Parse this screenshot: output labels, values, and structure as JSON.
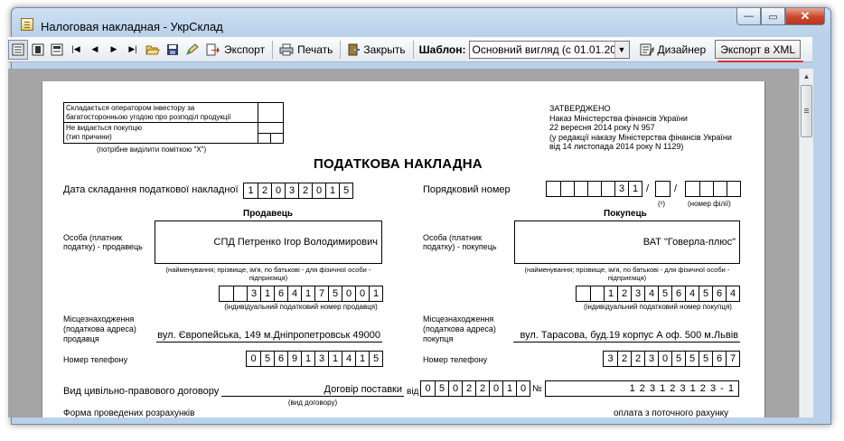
{
  "window": {
    "title": "Налоговая накладная - УкрСклад"
  },
  "toolbar": {
    "export_label": "Экспорт",
    "print_label": "Печать",
    "close_label": "Закрыть",
    "template_label": "Шаблон:",
    "template_value": "Основний вигляд (с 01.01.201!",
    "designer_label": "Дизайнер",
    "xml_export_label": "Экспорт в XML"
  },
  "doc": {
    "top_box": {
      "line1": "Складається оператором інвестору за",
      "line2": "багатосторонньою угодою про розподіл продукції",
      "line3": "Не видається покупцю",
      "line4": "(тип причини)",
      "note": "(потрібне виділити поміткою \"Х\")"
    },
    "approval": {
      "line1": "ЗАТВЕРДЖЕНО",
      "line2": "Наказ Міністерства фінансів України",
      "line3": "22 вересня 2014 року N 957",
      "line4": "(у редакції наказу Міністерства фінансів України",
      "line5": "від 14 листопада 2014 року N 1129)"
    },
    "title": "ПОДАТКОВА НАКЛАДНА",
    "date_label": "Дата складання податкової накладної",
    "date_digits": [
      "1",
      "2",
      "0",
      "3",
      "2",
      "0",
      "1",
      "5"
    ],
    "number_label": "Порядковий номер",
    "number_digits": [
      "",
      "",
      "",
      "",
      "",
      "3",
      "1"
    ],
    "number_sep1": "/",
    "number_sep2": "/",
    "number_note1": "(¹)",
    "number_note2": "(номер філії)",
    "seller": {
      "heading": "Продавець",
      "person_label_1": "Особа (платник",
      "person_label_2": "податку) - продавець",
      "name": "СПД Петренко Ігор Володимирович",
      "name_note_1": "(найменування; прізвище, ім'я, по батькові - для фізичної особи -",
      "name_note_2": "підприємця)",
      "ipn_digits": [
        "",
        "",
        "3",
        "1",
        "6",
        "4",
        "1",
        "7",
        "5",
        "0",
        "0",
        "1"
      ],
      "ipn_note": "(індивідуальний податковий номер продавця)",
      "address_label_1": "Місцезнаходження",
      "address_label_2": "(податкова адреса)",
      "address_label_3": "продавця",
      "address": "вул. Європейська, 149 м.Дніпропетровськ 49000",
      "phone_label": "Номер телефону",
      "phone_digits": [
        "0",
        "5",
        "6",
        "9",
        "1",
        "3",
        "1",
        "4",
        "1",
        "5"
      ]
    },
    "buyer": {
      "heading": "Покупець",
      "person_label_1": "Особа (платник",
      "person_label_2": "податку) - покупець",
      "name": "ВАТ \"Говерла-плюс\"",
      "name_note_1": "(найменування; прізвище, ім'я, по батькові - для фізичної особи -",
      "name_note_2": "підприємця)",
      "ipn_digits": [
        "",
        "",
        "1",
        "2",
        "3",
        "4",
        "5",
        "6",
        "4",
        "5",
        "6",
        "4"
      ],
      "ipn_note": "(індивідуальний податковий номер покупця)",
      "address_label_1": "Місцезнаходження",
      "address_label_2": "(податкова адреса)",
      "address_label_3": "покупця",
      "address": "вул. Тарасова, буд.19 корпус А оф. 500 м.Львів",
      "phone_label": "Номер телефону",
      "phone_digits": [
        "3",
        "2",
        "2",
        "3",
        "0",
        "5",
        "5",
        "5",
        "6",
        "7"
      ]
    },
    "contract": {
      "label": "Вид цивільно-правового договору",
      "type": "Договір поставки",
      "type_note": "(вид договору)",
      "from_label": "від",
      "date_digits": [
        "0",
        "5",
        "0",
        "2",
        "2",
        "0",
        "1",
        "0"
      ],
      "number_label": "№",
      "number": "1 2 3 1 2 3 1 2 3 - 1"
    },
    "payment": {
      "label": "Форма проведених розрахунків",
      "value": "оплата з поточного рахунку"
    }
  }
}
